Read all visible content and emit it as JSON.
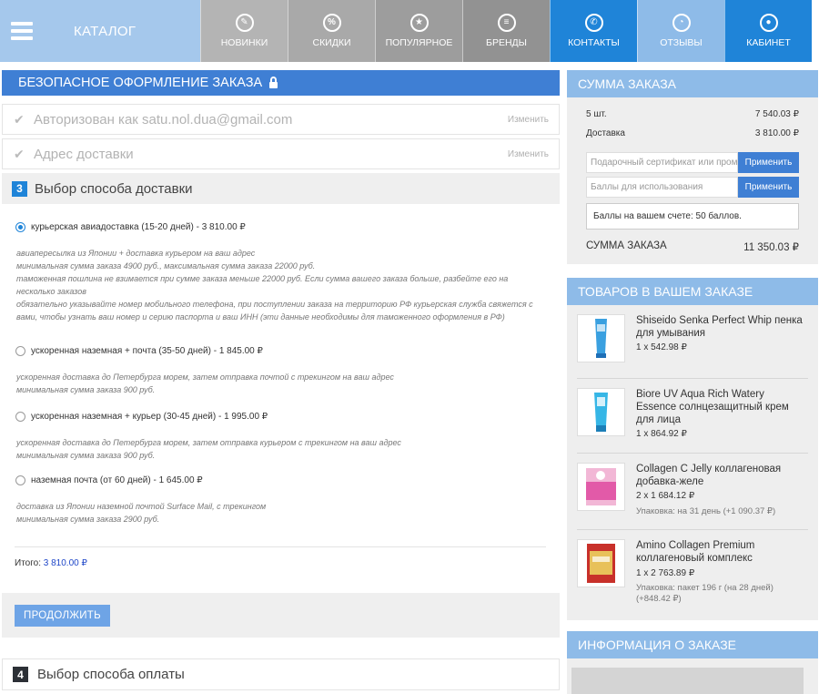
{
  "nav": {
    "catalog_label": "КАТАЛОГ",
    "items": [
      {
        "label": "НОВИНКИ",
        "icon": "tag-icon",
        "glyph": "✎"
      },
      {
        "label": "СКИДКИ",
        "icon": "percent-icon",
        "glyph": "%"
      },
      {
        "label": "ПОПУЛЯРНОЕ",
        "icon": "star-icon",
        "glyph": "★"
      },
      {
        "label": "БРЕНДЫ",
        "icon": "list-icon",
        "glyph": "≡"
      },
      {
        "label": "КОНТАКТЫ",
        "icon": "phone-icon",
        "glyph": "✆"
      },
      {
        "label": "ОТЗЫВЫ",
        "icon": "rss-icon",
        "glyph": "◔"
      },
      {
        "label": "КАБИНЕТ",
        "icon": "user-icon",
        "glyph": "●"
      }
    ]
  },
  "checkout": {
    "secure_title": "БЕЗОПАСНОЕ ОФОРМЛЕНИЕ ЗАКАЗА",
    "auth_text": "Авторизован как satu.nol.dua@gmail.com",
    "address_text": "Адрес доставки",
    "change_label": "Изменить",
    "step3_number": "3",
    "step3_title": "Выбор способа доставки",
    "options": [
      {
        "label": "курьерская авиадоставка (15-20 дней) - 3 810.00 ₽",
        "selected": true,
        "desc": [
          "авиапересылка из Японии + доставка курьером на ваш адрес",
          "минимальная сумма заказа 4900 руб., максимальная сумма заказа 22000 руб.",
          "таможенная пошлина не взимается при сумме заказа меньше 22000 руб. Если сумма вашего заказа больше, разбейте его на несколько заказов",
          "обязательно указывайте номер мобильного телефона, при поступлении заказа на территорию РФ курьерская служба свяжется с вами, чтобы узнать ваш номер и серию паспорта и ваш ИНН (эти данные необходимы для таможенного оформления в РФ)"
        ]
      },
      {
        "label": "ускоренная наземная + почта (35-50 дней) - 1 845.00 ₽",
        "selected": false,
        "desc": [
          "ускоренная доставка до Петербурга морем, затем отправка почтой с трекингом на ваш адрес",
          "минимальная сумма заказа 900 руб."
        ]
      },
      {
        "label": "ускоренная наземная + курьер (30-45 дней) - 1 995.00 ₽",
        "selected": false,
        "desc": [
          "ускоренная доставка до Петербурга морем, затем отправка курьером с трекингом на ваш адрес",
          "минимальная сумма заказа 900 руб."
        ]
      },
      {
        "label": "наземная почта (от 60 дней) - 1 645.00 ₽",
        "selected": false,
        "desc": [
          "доставка из Японии наземной почтой Surface Mail, с трекингом",
          "минимальная сумма заказа 2900 руб."
        ]
      }
    ],
    "total_label": "Итого:",
    "total_value": "3 810.00 ₽",
    "continue_label": "ПРОДОЛЖИТЬ",
    "step4_number": "4",
    "step4_title": "Выбор способа оплаты"
  },
  "summary": {
    "title": "СУММА ЗАКАЗА",
    "items_label": "5 шт.",
    "items_value": "7 540.03 ₽",
    "delivery_label": "Доставка",
    "delivery_value": "3 810.00 ₽",
    "promo_placeholder": "Подарочный сертификат или промо-код",
    "points_placeholder": "Баллы для использования",
    "apply_label": "Применить",
    "points_balance": "Баллы на вашем счете: 50 баллов.",
    "total_label": "СУММА ЗАКАЗА",
    "total_value": "11 350.03 ₽"
  },
  "cart": {
    "title": "ТОВАРОВ В ВАШЕМ ЗАКАЗЕ",
    "products": [
      {
        "name": "Shiseido Senka Perfect Whip пенка для умывания",
        "qty": "1 x 542.98 ₽",
        "pack": "",
        "color": "#3aa0e0"
      },
      {
        "name": "Biore UV Aqua Rich Watery Essence солнцезащитный крем для лица",
        "qty": "1 x 864.92 ₽",
        "pack": "",
        "color": "#36b6e6"
      },
      {
        "name": "Collagen C Jelly коллагеновая добавка-желе",
        "qty": "2 x 1 684.12 ₽",
        "pack": "Упаковка: на 31 день (+1 090.37 ₽)",
        "color": "#e25aa8"
      },
      {
        "name": "Amino Collagen Premium коллагеновый комплекс",
        "qty": "1 x 2 763.89 ₽",
        "pack": "Упаковка: пакет 196 г (на 28 дней) (+848.42 ₽)",
        "color": "#c8302a"
      }
    ]
  },
  "order_info": {
    "title": "ИНФОРМАЦИЯ О ЗАКАЗЕ"
  }
}
